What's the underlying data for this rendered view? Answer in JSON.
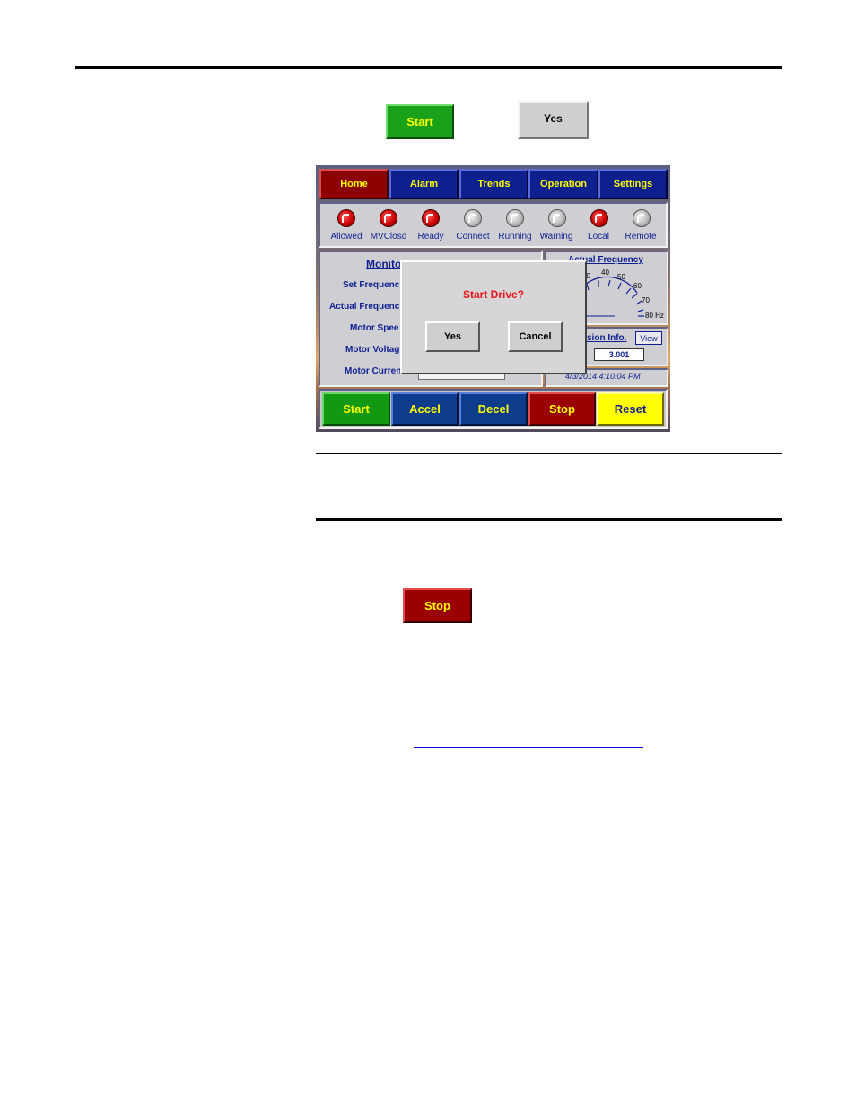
{
  "top_buttons": {
    "start_label": "Start",
    "yes_label": "Yes"
  },
  "hmi": {
    "nav": [
      {
        "label": "Home"
      },
      {
        "label": "Alarm"
      },
      {
        "label": "Trends"
      },
      {
        "label": "Operation"
      },
      {
        "label": "Settings"
      }
    ],
    "status_leds": [
      {
        "label": "Allowed",
        "state": "red"
      },
      {
        "label": "MVClosd",
        "state": "red"
      },
      {
        "label": "Ready",
        "state": "red"
      },
      {
        "label": "Connect",
        "state": "gray"
      },
      {
        "label": "Running",
        "state": "gray"
      },
      {
        "label": "Warning",
        "state": "gray"
      },
      {
        "label": "Local",
        "state": "red"
      },
      {
        "label": "Remote",
        "state": "gray"
      }
    ],
    "monitor": {
      "title": "Monito",
      "rows": [
        "Set Frequenc",
        "Actual Frequenc",
        "Motor Spee",
        "Motor Voltag",
        "Motor Curren"
      ]
    },
    "gauge": {
      "title": "Actual Frequency",
      "ticks": [
        "30",
        "40",
        "50",
        "60",
        "70",
        "80 Hz"
      ]
    },
    "version": {
      "title": "sion Info.",
      "view_label": "View",
      "value": "3.001"
    },
    "datetime": "4/3/2014 4:10:04 PM",
    "actions": [
      {
        "label": "Start",
        "style": "green"
      },
      {
        "label": "Accel",
        "style": "blue"
      },
      {
        "label": "Decel",
        "style": "blue"
      },
      {
        "label": "Stop",
        "style": "red"
      },
      {
        "label": "Reset",
        "style": "yellow"
      }
    ],
    "dialog": {
      "message": "Start Drive?",
      "yes_label": "Yes",
      "cancel_label": "Cancel"
    }
  },
  "stop_button_label": "Stop",
  "colors": {
    "nav_blue": "#0e1f8e",
    "home_red": "#8c0000",
    "label_blue": "#0d1f92",
    "accent_yellow": "#ffff00",
    "dialog_red": "#e8141c"
  }
}
